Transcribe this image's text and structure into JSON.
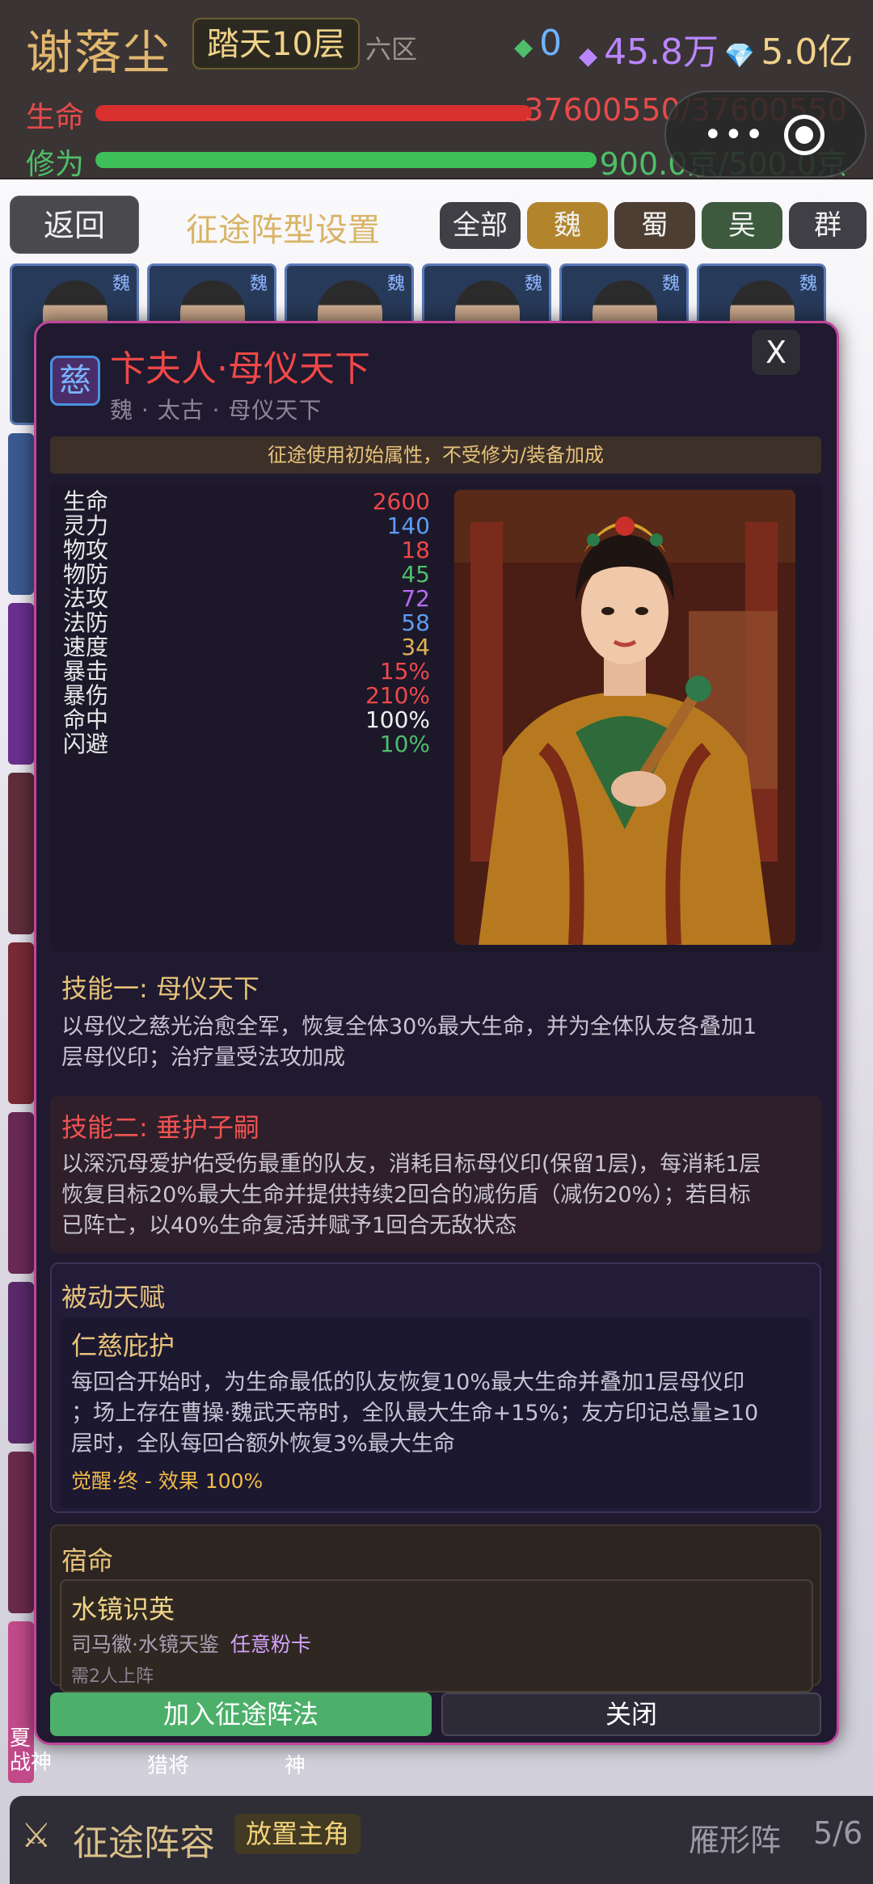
{
  "header": {
    "player_name": "谢落尘",
    "realm": "踏天10层",
    "zone": "六区",
    "resources": [
      {
        "icon": "jade-icon",
        "value": "0",
        "color": "#6fb3ff"
      },
      {
        "icon": "purple-crystal-icon",
        "value": "45.8万",
        "color": "#b986ff"
      },
      {
        "icon": "diamond-icon",
        "value": "5.0亿",
        "color": "#f1d28a"
      }
    ],
    "hp_label": "生命",
    "hp_value": "37600550/37600550",
    "hp_fill": 1.0,
    "cultivation_label": "修为",
    "cultivation_value": "900.0京/500.0京",
    "cultivation_fill": 1.0
  },
  "lineup": {
    "back_label": "返回",
    "title": "征途阵型设置",
    "faction_tabs": [
      {
        "label": "全部",
        "color": "#3f3f45",
        "selected": false
      },
      {
        "label": "魏",
        "color": "#b2852d",
        "selected": true
      },
      {
        "label": "蜀",
        "color": "#4d3e34",
        "selected": false
      },
      {
        "label": "吴",
        "color": "#3d5a3f",
        "selected": false
      },
      {
        "label": "群",
        "color": "#3f3f45",
        "selected": false
      }
    ],
    "card_faction": "魏"
  },
  "modal": {
    "seal": "慈",
    "name": "卞夫人·母仪天下",
    "subtitle": "魏 · 太古 · 母仪天下",
    "close": "X",
    "notice": "征途使用初始属性，不受修为/装备加成",
    "stats": [
      {
        "label": "生命",
        "value": "2600",
        "color": "#ef4848"
      },
      {
        "label": "灵力",
        "value": "140",
        "color": "#5f9cf2"
      },
      {
        "label": "物攻",
        "value": "18",
        "color": "#ef4848"
      },
      {
        "label": "物防",
        "value": "45",
        "color": "#4fbe6a"
      },
      {
        "label": "法攻",
        "value": "72",
        "color": "#b76cf2"
      },
      {
        "label": "法防",
        "value": "58",
        "color": "#5f9cf2"
      },
      {
        "label": "速度",
        "value": "34",
        "color": "#e2b254"
      },
      {
        "label": "暴击",
        "value": "15%",
        "color": "#ef4848"
      },
      {
        "label": "暴伤",
        "value": "210%",
        "color": "#ef4848"
      },
      {
        "label": "命中",
        "value": "100%",
        "color": "#f0f0f0"
      },
      {
        "label": "闪避",
        "value": "10%",
        "color": "#4fbe6a"
      }
    ],
    "skill1": {
      "title": "技能一: 母仪天下",
      "text1": "以母仪之慈光治愈全军，恢复全体30%最大生命，并为全体队友各叠加1",
      "text2": "层母仪印；治疗量受法攻加成"
    },
    "skill2": {
      "title": "技能二: 垂护子嗣",
      "text1": "以深沉母爱护佑受伤最重的队友，消耗目标母仪印(保留1层)，每消耗1层",
      "text2": "恢复目标20%最大生命并提供持续2回合的减伤盾（减伤20%）；若目标",
      "text3": "已阵亡，以40%生命复活并赋予1回合无敌状态"
    },
    "passive": {
      "header": "被动天赋",
      "title": "仁慈庇护",
      "text1": "每回合开始时，为生命最低的队友恢复10%最大生命并叠加1层母仪印",
      "text2": "；场上存在曹操·魏武天帝时，全队最大生命+15%；友方印记总量≥10",
      "text3": "层时，全队每回合额外恢复3%最大生命",
      "awaken": "觉醒·终 - 效果 100%"
    },
    "fate": {
      "header": "宿命",
      "title": "水镜识英",
      "members": "司马徽·水镜天鉴",
      "extra": "任意粉卡",
      "req": "需2人上阵"
    },
    "join_label": "加入征途阵法",
    "close_label": "关闭"
  },
  "under": {
    "labels": [
      "夏",
      "战神",
      "猎将",
      "神"
    ]
  },
  "bottom": {
    "title": "征途阵容",
    "placer": "放置主角",
    "formation": "雁形阵",
    "count": "5/6"
  }
}
